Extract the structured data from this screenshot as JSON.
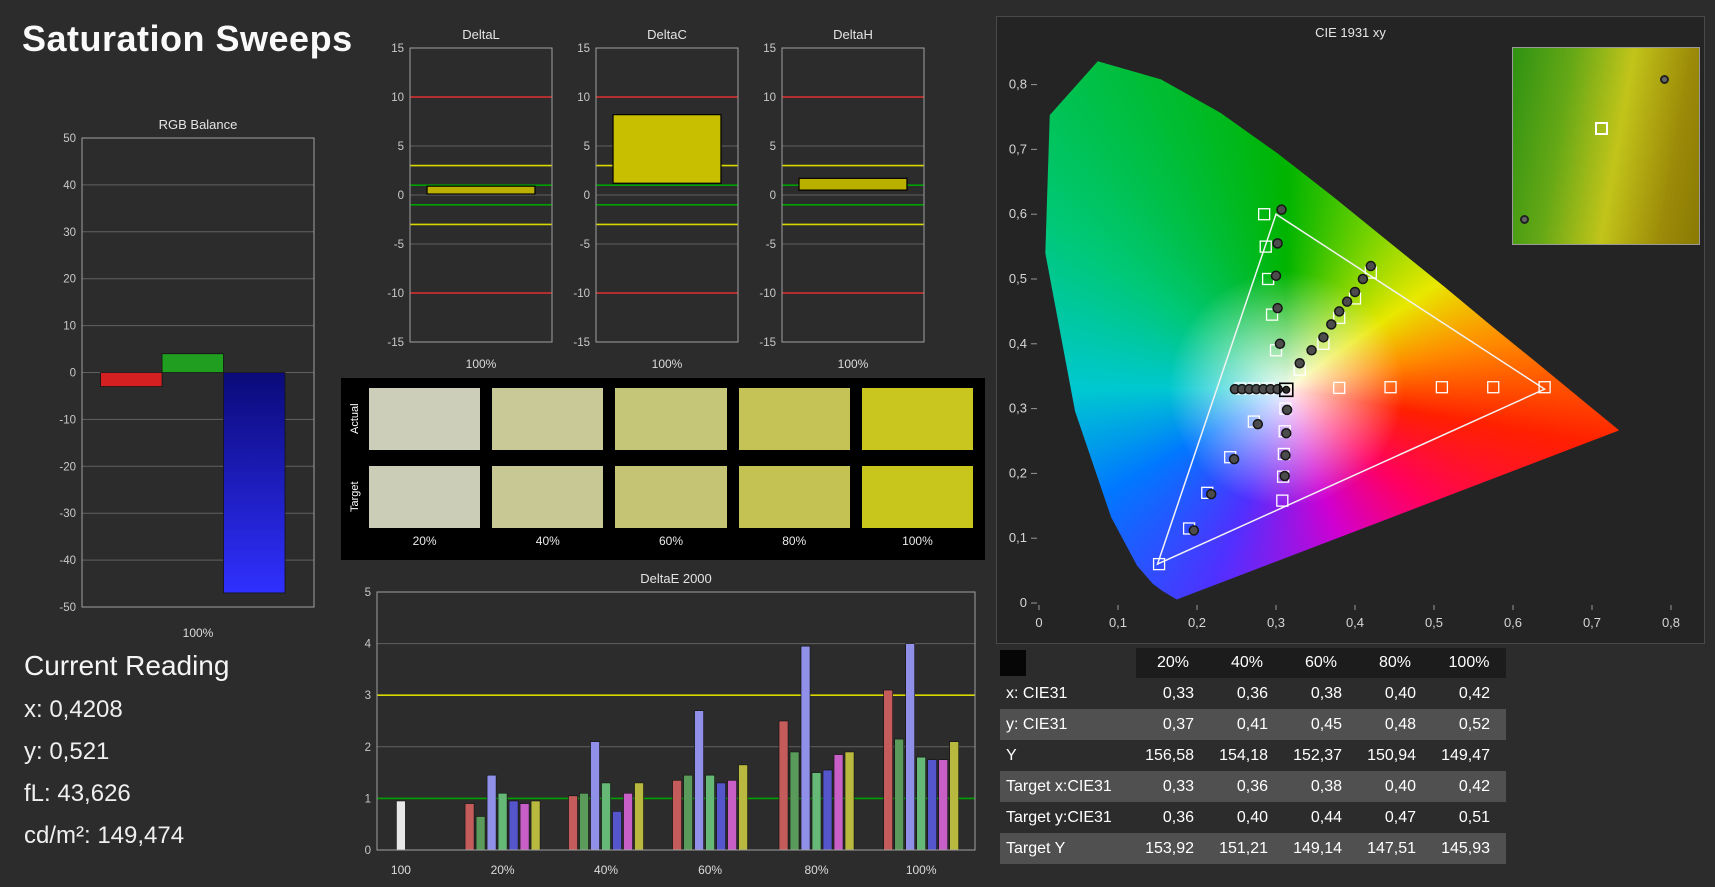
{
  "page": {
    "title": "Saturation Sweeps",
    "background": "#2c2c2c"
  },
  "current_reading": {
    "heading": "Current Reading",
    "lines": [
      "x: 0,4208",
      "y: 0,521",
      "fL: 43,626",
      "cd/m²: 149,474"
    ]
  },
  "swatch_panel": {
    "row_labels": [
      "Actual",
      "Target"
    ],
    "col_labels": [
      "20%",
      "40%",
      "60%",
      "80%",
      "100%"
    ],
    "actual": [
      "#cdceb9",
      "#c9c997",
      "#c6c678",
      "#c5c355",
      "#c9c71f"
    ],
    "target": [
      "#cccdb6",
      "#c8c894",
      "#c5c475",
      "#c4c252",
      "#c8c61d"
    ]
  },
  "table": {
    "columns": [
      "",
      "20%",
      "40%",
      "60%",
      "80%",
      "100%"
    ],
    "rows": [
      {
        "label": "x: CIE31",
        "values": [
          "0,33",
          "0,36",
          "0,38",
          "0,40",
          "0,42"
        ],
        "shaded": false
      },
      {
        "label": "y: CIE31",
        "values": [
          "0,37",
          "0,41",
          "0,45",
          "0,48",
          "0,52"
        ],
        "shaded": true
      },
      {
        "label": "Y",
        "values": [
          "156,58",
          "154,18",
          "152,37",
          "150,94",
          "149,47"
        ],
        "shaded": false
      },
      {
        "label": "Target x:CIE31",
        "values": [
          "0,33",
          "0,36",
          "0,38",
          "0,40",
          "0,42"
        ],
        "shaded": true
      },
      {
        "label": "Target y:CIE31",
        "values": [
          "0,36",
          "0,40",
          "0,44",
          "0,47",
          "0,51"
        ],
        "shaded": false
      },
      {
        "label": "Target Y",
        "values": [
          "153,92",
          "151,21",
          "149,14",
          "147,51",
          "145,93"
        ],
        "shaded": true
      }
    ]
  },
  "chart_data": [
    {
      "id": "rgb_balance",
      "type": "bar",
      "title": "RGB Balance",
      "xlabel": "100%",
      "ylim": [
        -50,
        50
      ],
      "yticks": [
        50,
        40,
        30,
        20,
        10,
        0,
        -10,
        -20,
        -30,
        -40,
        -50
      ],
      "series": [
        {
          "name": "Red",
          "color": "#d42020",
          "values": [
            -3
          ]
        },
        {
          "name": "Green",
          "color": "#1f9e1f",
          "values": [
            4
          ]
        },
        {
          "name": "Blue",
          "color": "#2020e8",
          "gradient": [
            "#0a0a78",
            "#3030ff"
          ],
          "values": [
            -47
          ]
        }
      ]
    },
    {
      "id": "deltaL",
      "type": "bar",
      "title": "DeltaL",
      "xlabel": "100%",
      "ylim": [
        -15,
        15
      ],
      "yticks": [
        15,
        10,
        5,
        0,
        -5,
        -10,
        -15
      ],
      "ref_lines": [
        {
          "y": 10,
          "color": "#e03030"
        },
        {
          "y": -10,
          "color": "#e03030"
        },
        {
          "y": 3,
          "color": "#d8d800"
        },
        {
          "y": -3,
          "color": "#d8d800"
        },
        {
          "y": 1,
          "color": "#00a000"
        },
        {
          "y": -1,
          "color": "#00a000"
        }
      ],
      "bar": {
        "from": 0.1,
        "to": 0.9,
        "color": "#b9b000"
      }
    },
    {
      "id": "deltaC",
      "type": "bar",
      "title": "DeltaC",
      "xlabel": "100%",
      "ylim": [
        -15,
        15
      ],
      "yticks": [
        15,
        10,
        5,
        0,
        -5,
        -10,
        -15
      ],
      "ref_lines": [
        {
          "y": 10,
          "color": "#e03030"
        },
        {
          "y": -10,
          "color": "#e03030"
        },
        {
          "y": 3,
          "color": "#d8d800"
        },
        {
          "y": -3,
          "color": "#d8d800"
        },
        {
          "y": 1,
          "color": "#00a000"
        },
        {
          "y": -1,
          "color": "#00a000"
        }
      ],
      "bar": {
        "from": 1.2,
        "to": 8.2,
        "color": "#c8bf00"
      }
    },
    {
      "id": "deltaH",
      "type": "bar",
      "title": "DeltaH",
      "xlabel": "100%",
      "ylim": [
        -15,
        15
      ],
      "yticks": [
        15,
        10,
        5,
        0,
        -5,
        -10,
        -15
      ],
      "ref_lines": [
        {
          "y": 10,
          "color": "#e03030"
        },
        {
          "y": -10,
          "color": "#e03030"
        },
        {
          "y": 3,
          "color": "#d8d800"
        },
        {
          "y": -3,
          "color": "#d8d800"
        },
        {
          "y": 1,
          "color": "#00a000"
        },
        {
          "y": -1,
          "color": "#00a000"
        }
      ],
      "bar": {
        "from": 0.5,
        "to": 1.7,
        "color": "#b9b000"
      }
    },
    {
      "id": "deltaE2000",
      "type": "bar",
      "title": "DeltaE 2000",
      "ylim": [
        0,
        5
      ],
      "yticks": [
        0,
        1,
        2,
        3,
        4,
        5
      ],
      "ref_lines": [
        {
          "y": 3,
          "color": "#d8d800"
        },
        {
          "y": 1,
          "color": "#00a000"
        }
      ],
      "bar_colors": [
        "#c45c5c",
        "#5a9a5a",
        "#9090e8",
        "#66b877",
        "#5555cc",
        "#c75fc7",
        "#b9b93f"
      ],
      "groups": [
        {
          "label": "100",
          "colors": [
            "#e8e8e8"
          ],
          "values": [
            0.95
          ]
        },
        {
          "label": "20%",
          "values": [
            0.9,
            0.65,
            1.45,
            1.1,
            0.95,
            0.9,
            0.95
          ]
        },
        {
          "label": "40%",
          "values": [
            1.05,
            1.1,
            2.1,
            1.3,
            0.75,
            1.1,
            1.3
          ]
        },
        {
          "label": "60%",
          "values": [
            1.35,
            1.45,
            2.7,
            1.45,
            1.3,
            1.35,
            1.65
          ]
        },
        {
          "label": "80%",
          "values": [
            2.5,
            1.9,
            3.95,
            1.5,
            1.55,
            1.85,
            1.9
          ]
        },
        {
          "label": "100%",
          "values": [
            3.1,
            2.15,
            4.0,
            1.8,
            1.75,
            1.75,
            2.1
          ]
        }
      ]
    },
    {
      "id": "cie",
      "type": "scatter",
      "title": "CIE 1931 xy",
      "xlim": [
        0,
        0.8
      ],
      "ylim": [
        0,
        0.9
      ],
      "xtick_labels": [
        "0",
        "0,1",
        "0,2",
        "0,3",
        "0,4",
        "0,5",
        "0,6",
        "0,7",
        "0,8"
      ],
      "ytick_labels": [
        "0",
        "0,1",
        "0,2",
        "0,3",
        "0,4",
        "0,5",
        "0,6",
        "0,7",
        "0,8"
      ],
      "gamut_triangle": [
        [
          0.64,
          0.33
        ],
        [
          0.3,
          0.6
        ],
        [
          0.15,
          0.06
        ]
      ],
      "white_point": [
        0.313,
        0.329
      ],
      "sweeps": [
        {
          "name": "red",
          "targets": [
            [
              0.38,
              0.332
            ],
            [
              0.445,
              0.333
            ],
            [
              0.51,
              0.333
            ],
            [
              0.575,
              0.333
            ],
            [
              0.64,
              0.333
            ]
          ],
          "measured": []
        },
        {
          "name": "green",
          "targets": [
            [
              0.3,
              0.39
            ],
            [
              0.295,
              0.445
            ],
            [
              0.29,
              0.5
            ],
            [
              0.287,
              0.55
            ],
            [
              0.285,
              0.6
            ]
          ],
          "measured": [
            [
              0.305,
              0.4
            ],
            [
              0.302,
              0.455
            ],
            [
              0.3,
              0.505
            ],
            [
              0.302,
              0.555
            ],
            [
              0.307,
              0.607
            ]
          ]
        },
        {
          "name": "blue",
          "targets": [
            [
              0.272,
              0.28
            ],
            [
              0.242,
              0.225
            ],
            [
              0.213,
              0.17
            ],
            [
              0.19,
              0.115
            ],
            [
              0.152,
              0.06
            ]
          ],
          "measured": [
            [
              0.277,
              0.276
            ],
            [
              0.247,
              0.222
            ],
            [
              0.218,
              0.168
            ],
            [
              0.196,
              0.112
            ]
          ]
        },
        {
          "name": "cyan",
          "targets": [
            [
              0.29,
              0.331
            ],
            [
              0.272,
              0.331
            ],
            [
              0.255,
              0.331
            ]
          ],
          "measured": [
            [
              0.248,
              0.33
            ],
            [
              0.257,
              0.33
            ],
            [
              0.266,
              0.33
            ],
            [
              0.275,
              0.33
            ],
            [
              0.284,
              0.33
            ],
            [
              0.293,
              0.33
            ],
            [
              0.302,
              0.33
            ]
          ]
        },
        {
          "name": "magenta",
          "targets": [
            [
              0.312,
              0.3
            ],
            [
              0.311,
              0.265
            ],
            [
              0.31,
              0.23
            ],
            [
              0.309,
              0.195
            ],
            [
              0.308,
              0.158
            ]
          ],
          "measured": [
            [
              0.314,
              0.298
            ],
            [
              0.313,
              0.262
            ],
            [
              0.312,
              0.228
            ],
            [
              0.311,
              0.196
            ]
          ]
        },
        {
          "name": "yellow",
          "targets": [
            [
              0.33,
              0.36
            ],
            [
              0.36,
              0.4
            ],
            [
              0.38,
              0.44
            ],
            [
              0.4,
              0.47
            ],
            [
              0.42,
              0.51
            ]
          ],
          "measured": [
            [
              0.33,
              0.37
            ],
            [
              0.345,
              0.39
            ],
            [
              0.36,
              0.41
            ],
            [
              0.37,
              0.43
            ],
            [
              0.38,
              0.45
            ],
            [
              0.39,
              0.465
            ],
            [
              0.4,
              0.48
            ],
            [
              0.41,
              0.5
            ],
            [
              0.42,
              0.52
            ]
          ]
        }
      ]
    }
  ]
}
